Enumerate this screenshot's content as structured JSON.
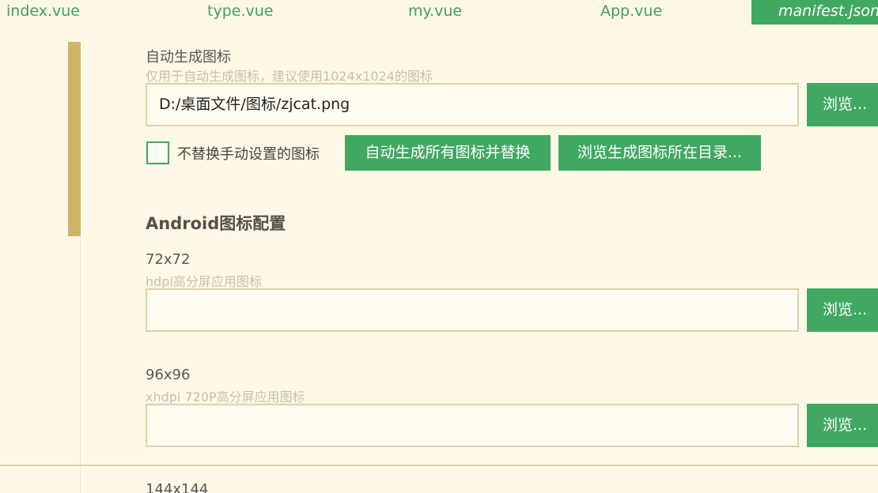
{
  "tabs": [
    {
      "label": "index.vue"
    },
    {
      "label": "type.vue"
    },
    {
      "label": "my.vue"
    },
    {
      "label": "App.vue"
    },
    {
      "label": "manifest.json"
    }
  ],
  "auto_icon": {
    "label": "自动生成图标",
    "hint": "仅用于自动生成图标，建议使用1024x1024的图标",
    "path_value": "D:/桌面文件/图标/zjcat.png",
    "browse_label": "浏览...",
    "checkbox_label": "不替换手动设置的图标",
    "checkbox_checked": false,
    "generate_button": "自动生成所有图标并替换",
    "browse_dir_button": "浏览生成图标所在目录..."
  },
  "android": {
    "section_title": "Android图标配置",
    "icons": [
      {
        "size": "72x72",
        "hint": "hdpi高分屏应用图标",
        "value": "",
        "browse_label": "浏览..."
      },
      {
        "size": "96x96",
        "hint": "xhdpi 720P高分屏应用图标",
        "value": "",
        "browse_label": "浏览..."
      },
      {
        "size": "144x144"
      }
    ]
  },
  "colors": {
    "accent": "#41a862",
    "background": "#fef9e7",
    "scroll_thumb": "#ceb466",
    "field_border": "#ddd1a8"
  }
}
